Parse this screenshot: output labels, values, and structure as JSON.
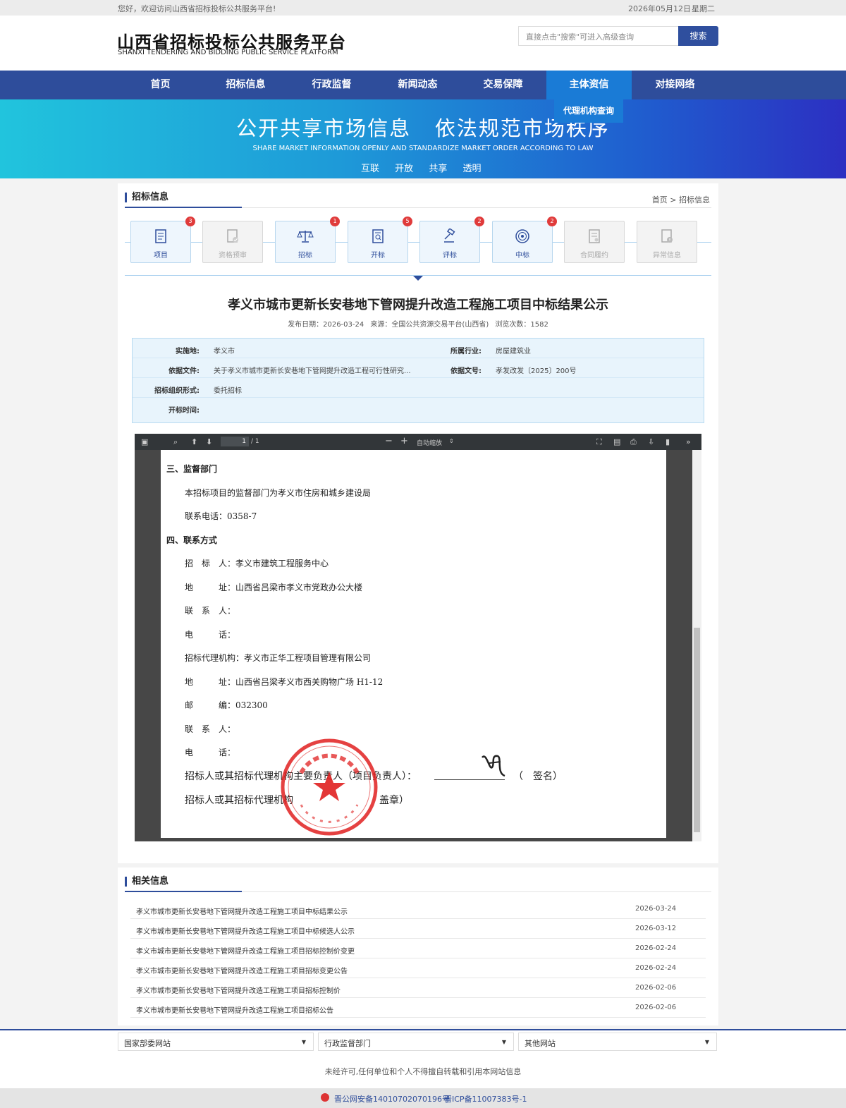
{
  "topbar": {
    "welcome": "您好，欢迎访问山西省招标投标公共服务平台!",
    "date": "2026年05月12日",
    "weekday": "星期二"
  },
  "header": {
    "title_cn": "山西省招标投标公共服务平台",
    "title_en": "SHANXI TENDERING AND BIDDING PUBLIC SERVICE PLATFORM",
    "search_placeholder": "直接点击\"搜索\"可进入高级查询",
    "search_button": "搜索"
  },
  "nav": {
    "items": [
      {
        "label": "首页"
      },
      {
        "label": "招标信息"
      },
      {
        "label": "行政监督"
      },
      {
        "label": "新闻动态"
      },
      {
        "label": "交易保障"
      },
      {
        "label": "主体资信"
      },
      {
        "label": "对接网络"
      }
    ],
    "active_index": 5,
    "dropdown_label": "代理机构查询"
  },
  "banner": {
    "slogan": "公开共享市场信息   依法规范市场秩序",
    "slogan_en": "SHARE MARKET INFORMATION OPENLY AND STANDARDIZE MARKET ORDER ACCORDING TO LAW",
    "tags": [
      "互联",
      "开放",
      "共享",
      "透明"
    ]
  },
  "section": {
    "title": "招标信息",
    "breadcrumb": "首页 > 招标信息"
  },
  "steps": [
    {
      "label": "项目",
      "badge": "3",
      "enabled": true,
      "icon": "document-icon"
    },
    {
      "label": "资格预审",
      "badge": "",
      "enabled": false,
      "icon": "check-doc-icon"
    },
    {
      "label": "招标",
      "badge": "1",
      "enabled": true,
      "icon": "scale-icon"
    },
    {
      "label": "开标",
      "badge": "5",
      "enabled": true,
      "icon": "search-doc-icon"
    },
    {
      "label": "评标",
      "badge": "2",
      "enabled": true,
      "icon": "gavel-icon"
    },
    {
      "label": "中标",
      "badge": "2",
      "enabled": true,
      "icon": "target-icon"
    },
    {
      "label": "合同履约",
      "badge": "",
      "enabled": false,
      "icon": "contract-icon"
    },
    {
      "label": "异常信息",
      "badge": "",
      "enabled": false,
      "icon": "warning-doc-icon"
    }
  ],
  "doc": {
    "title": "孝义市城市更新长安巷地下管网提升改造工程施工项目中标结果公示",
    "publish_date": "发布日期：2026-03-24",
    "source": "来源：全国公共资源交易平台(山西省)",
    "views": "浏览次数：1582"
  },
  "info": {
    "location_key": "实施地:",
    "location": "孝义市",
    "industry_key": "所属行业:",
    "industry": "房屋建筑业",
    "basis_file_key": "依据文件:",
    "basis_file": "关于孝义市城市更新长安巷地下管网提升改造工程可行性研究...",
    "basis_no_key": "依据文号:",
    "basis_no": "孝发改发〔2025〕200号",
    "org_form_key": "招标组织形式:",
    "org_form": "委托招标",
    "open_time_key": "开标时间:",
    "open_time": ""
  },
  "viewer": {
    "page": "1",
    "page_total": "/ 1",
    "zoom": "自动缩放"
  },
  "pdf": {
    "l1": "三、监督部门",
    "l2": "本招标项目的监督部门为孝义市住房和城乡建设局",
    "l3": "联系电话：0358-7",
    "l4": "四、联系方式",
    "l5": "招　标　人：孝义市建筑工程服务中心",
    "l6": "地　　　址：山西省吕梁市孝义市党政办公大楼",
    "l7": "联　系　人：",
    "l8": "电　　　话：",
    "l9": "招标代理机构：孝义市正华工程项目管理有限公司",
    "l10": "地　　　址：山西省吕梁孝义市西关购物广场 H1-12",
    "l11": "邮　　　编：032300",
    "l12": "联　系　人：",
    "l13": "电　　　话：",
    "l14": "招标人或其招标代理机构主要负责人（项目负责人）：",
    "l14b": "（　签名）",
    "l15": "招标人或其招标代理机构",
    "l15b": "盖章）"
  },
  "related": {
    "title": "相关信息",
    "items": [
      {
        "title": "孝义市城市更新长安巷地下管网提升改造工程施工项目中标结果公示",
        "date": "2026-03-24"
      },
      {
        "title": "孝义市城市更新长安巷地下管网提升改造工程施工项目中标候选人公示",
        "date": "2026-03-12"
      },
      {
        "title": "孝义市城市更新长安巷地下管网提升改造工程施工项目招标控制价变更",
        "date": "2026-02-24"
      },
      {
        "title": "孝义市城市更新长安巷地下管网提升改造工程施工项目招标变更公告",
        "date": "2026-02-24"
      },
      {
        "title": "孝义市城市更新长安巷地下管网提升改造工程施工项目招标控制价",
        "date": "2026-02-06"
      },
      {
        "title": "孝义市城市更新长安巷地下管网提升改造工程施工项目招标公告",
        "date": "2026-02-06"
      }
    ]
  },
  "footer": {
    "selects": [
      "国家部委网站",
      "行政监督部门",
      "其他网站"
    ],
    "note": "未经许可,任何单位和个人不得擅自转载和引用本网站信息",
    "police": "晋公网安备14010702070196号",
    "icp": "晋ICP备11007383号-1"
  },
  "colors": {
    "nav": "#2e4d9b",
    "nav_active": "#1a7bd6",
    "badge": "#e03b3b",
    "info_bg": "#e8f4fc"
  }
}
